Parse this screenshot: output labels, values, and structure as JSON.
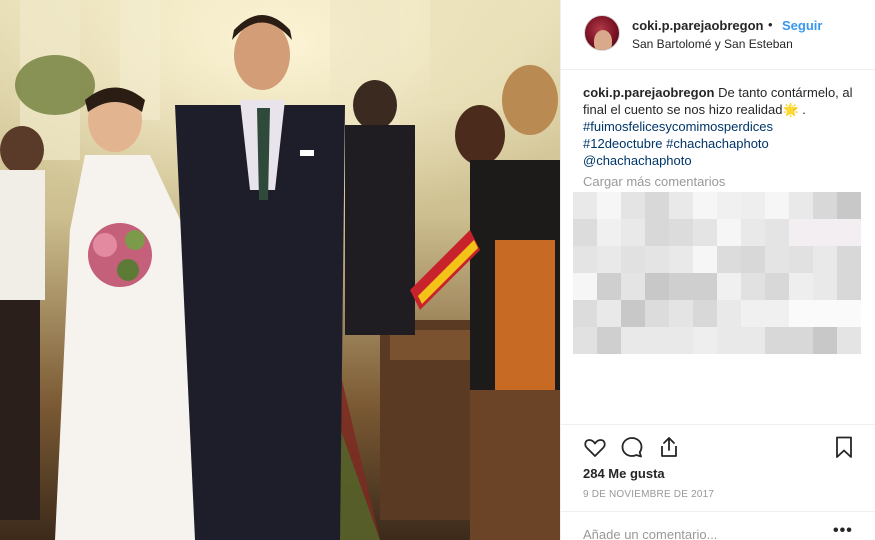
{
  "post": {
    "username": "coki.p.parejaobregon",
    "separator": "•",
    "follow_label": "Seguir",
    "location": "San Bartolomé y San Esteban",
    "caption": {
      "username": "coki.p.parejaobregon",
      "text": "De tanto contármelo, al final el cuento se nos hizo realidad",
      "emoji": "🌟",
      "tail": ".",
      "hashtags": [
        "#fuimosfelicesycomimosperdices",
        "#12deoctubre #chachachaphoto"
      ],
      "mention": "@chachachaphoto"
    },
    "load_more_label": "Cargar más comentarios",
    "likes_label": "284 Me gusta",
    "date_label": "9 DE NOVIEMBRE DE 2017",
    "comment_placeholder": "Añade un comentario...",
    "more_options_label": "•••"
  },
  "icons": {
    "like": "heart-icon",
    "comment": "comment-icon",
    "share": "share-icon",
    "save": "bookmark-icon",
    "more": "more-options-icon"
  },
  "colors": {
    "link_blue": "#3897f0",
    "hashtag_blue": "#003569",
    "muted_gray": "#999999",
    "text": "#262626",
    "divider": "#efefef"
  }
}
